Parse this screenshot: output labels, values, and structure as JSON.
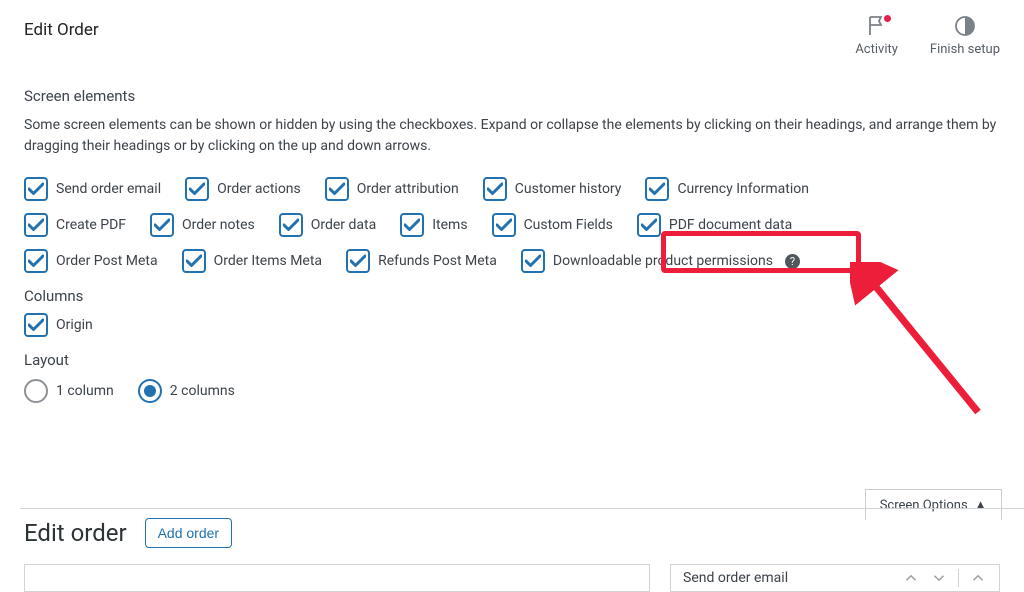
{
  "header": {
    "title": "Edit Order",
    "actions": {
      "activity": "Activity",
      "finish": "Finish setup"
    }
  },
  "screen_elements": {
    "title": "Screen elements",
    "description": "Some screen elements can be shown or hidden by using the checkboxes. Expand or collapse the elements by clicking on their headings, and arrange them by dragging their headings or by clicking on the up and down arrows.",
    "rows": [
      [
        "Send order email",
        "Order actions",
        "Order attribution",
        "Customer history",
        "Currency Information"
      ],
      [
        "Create PDF",
        "Order notes",
        "Order data",
        "Items",
        "Custom Fields",
        "PDF document data"
      ],
      [
        "Order Post Meta",
        "Order Items Meta",
        "Refunds Post Meta",
        "Downloadable product permissions"
      ]
    ]
  },
  "columns": {
    "title": "Columns",
    "items": [
      "Origin"
    ]
  },
  "layout": {
    "title": "Layout",
    "options": [
      "1 column",
      "2 columns"
    ],
    "selected": 1
  },
  "screen_options_tab": "Screen Options",
  "lower": {
    "title": "Edit order",
    "add_label": "Add order",
    "right_panel": "Send order email"
  }
}
